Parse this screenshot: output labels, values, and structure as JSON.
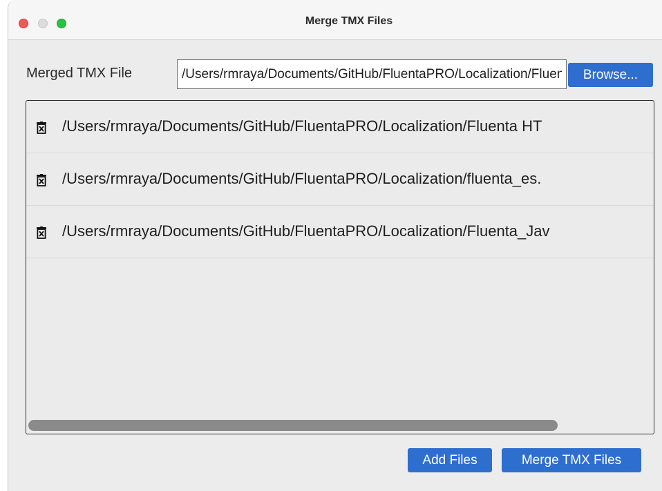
{
  "window": {
    "title": "Merge TMX Files"
  },
  "merged_file": {
    "label": "Merged TMX File",
    "value": "/Users/rmraya/Documents/GitHub/FluentaPRO/Localization/Fluenta_merged.tmx",
    "browse_label": "Browse..."
  },
  "files": [
    {
      "path": "/Users/rmraya/Documents/GitHub/FluentaPRO/Localization/Fluenta HT",
      "icon": "trash-icon"
    },
    {
      "path": "/Users/rmraya/Documents/GitHub/FluentaPRO/Localization/fluenta_es.",
      "icon": "trash-icon"
    },
    {
      "path": "/Users/rmraya/Documents/GitHub/FluentaPRO/Localization/Fluenta_Jav",
      "icon": "trash-icon"
    }
  ],
  "actions": {
    "add_files_label": "Add Files",
    "merge_label": "Merge TMX Files"
  },
  "colors": {
    "accent": "#2e6ecf",
    "window_bg": "#ececec",
    "close": "#ee5b57",
    "zoom": "#29c240"
  }
}
